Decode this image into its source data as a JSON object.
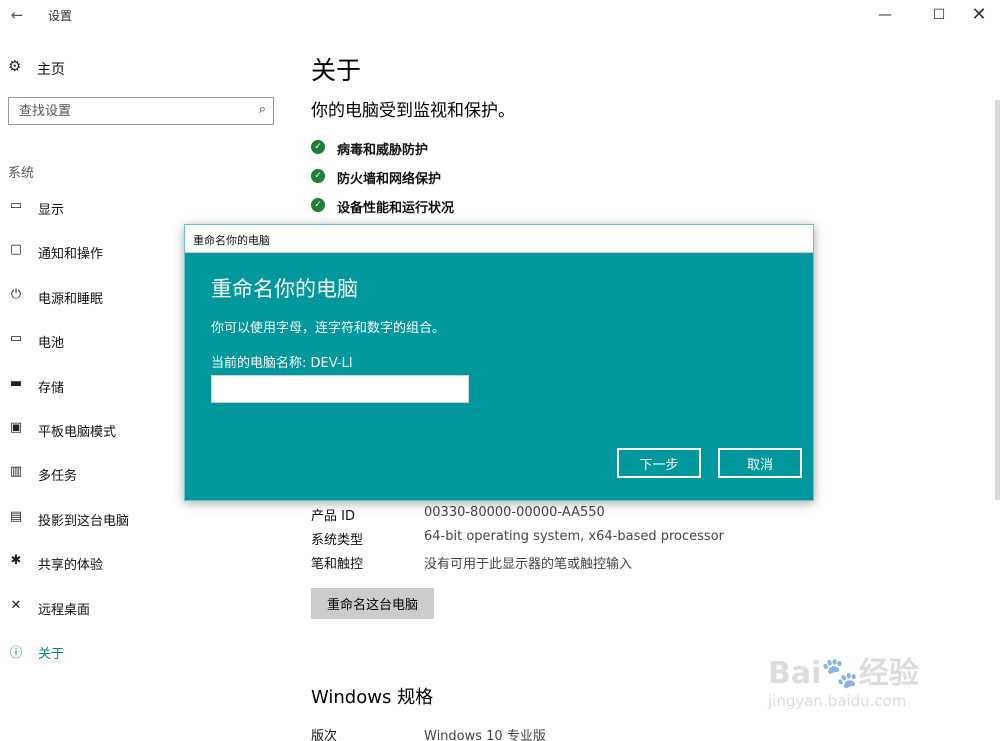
{
  "window": {
    "back_icon": "←",
    "title": "设置",
    "minimize_icon": "—",
    "maximize_icon": "☐",
    "close_icon": "✕"
  },
  "sidebar": {
    "home_label": "主页",
    "home_icon": "⚙",
    "search_placeholder": "查找设置",
    "search_icon": "⌕",
    "section_label": "系统",
    "items": [
      {
        "label": "显示",
        "icon": "▭"
      },
      {
        "label": "通知和操作",
        "icon": "▢"
      },
      {
        "label": "电源和睡眠",
        "icon": "⏻"
      },
      {
        "label": "电池",
        "icon": "▭"
      },
      {
        "label": "存储",
        "icon": "▬"
      },
      {
        "label": "平板电脑模式",
        "icon": "▣"
      },
      {
        "label": "多任务",
        "icon": "▥"
      },
      {
        "label": "投影到这台电脑",
        "icon": "▤"
      },
      {
        "label": "共享的体验",
        "icon": "✱"
      },
      {
        "label": "远程桌面",
        "icon": "✕"
      },
      {
        "label": "关于",
        "icon": "ⓘ",
        "active": true
      }
    ]
  },
  "main": {
    "title": "关于",
    "protection_heading": "你的电脑受到监视和保护。",
    "protection_items": [
      "病毒和威胁防护",
      "防火墙和网络保护",
      "设备性能和运行状况"
    ],
    "check_icon": "✓",
    "specs": [
      {
        "key": "产品 ID",
        "value": "00330-80000-00000-AA550"
      },
      {
        "key": "系统类型",
        "value": "64-bit operating system, x64-based processor"
      },
      {
        "key": "笔和触控",
        "value": "没有可用于此显示器的笔或触控输入"
      }
    ],
    "rename_button": "重命名这台电脑",
    "windows_spec_heading": "Windows 规格",
    "windows_specs": [
      {
        "key": "版次",
        "value": "Windows 10 专业版"
      }
    ]
  },
  "dialog": {
    "window_title": "重命名你的电脑",
    "heading": "重命名你的电脑",
    "description": "你可以使用字母，连字符和数字的组合。",
    "current_name_label": "当前的电脑名称: DEV-LI",
    "input_value": "",
    "next_button": "下一步",
    "cancel_button": "取消",
    "accent_color": "#00979d"
  },
  "watermark": {
    "line1": "Bai🐾经验",
    "line2": "jingyan.baidu.com"
  }
}
